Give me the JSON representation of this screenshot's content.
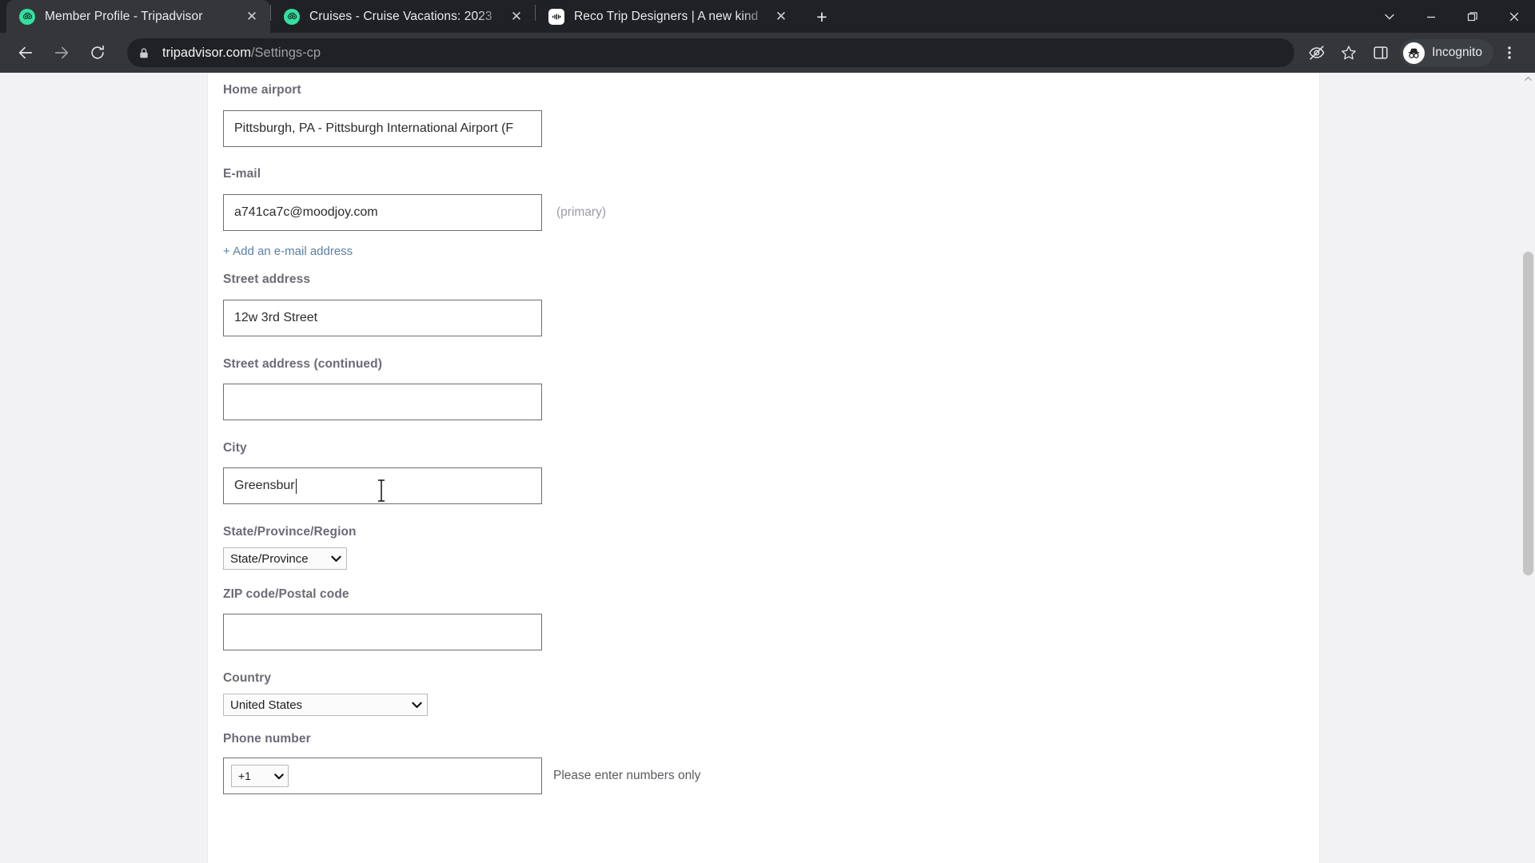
{
  "window": {
    "controls": {
      "tab_search": "tab-search-chevron",
      "minimize": "minimize",
      "maximize": "maximize",
      "close": "close"
    }
  },
  "tabstrip": {
    "new_tab_label": "+",
    "tabs": [
      {
        "title": "Member Profile - Tripadvisor",
        "favicon": "tripadvisor-owl-icon",
        "active": true,
        "close_label": "✕"
      },
      {
        "title": "Cruises - Cruise Vacations: 2023",
        "favicon": "tripadvisor-owl-icon",
        "active": false,
        "close_label": "✕"
      },
      {
        "title": "Reco Trip Designers | A new kind",
        "favicon": "reco-icon",
        "active": false,
        "close_label": "✕"
      }
    ]
  },
  "toolbar": {
    "back_label": "back-arrow",
    "forward_label": "forward-arrow",
    "reload_label": "reload",
    "security_icon": "lock-icon",
    "url_host": "tripadvisor.com",
    "url_path": "/Settings-cp",
    "url_full": "tripadvisor.com/Settings-cp",
    "icons": {
      "third_party_cookies": "eye-off-icon",
      "bookmark": "star-icon",
      "side_panel": "side-panel-icon",
      "menu": "three-dot-menu-icon"
    },
    "profile_label": "Incognito"
  },
  "page": {
    "fields": {
      "home_airport": {
        "label": "Home airport",
        "value": "Pittsburgh, PA - Pittsburgh International Airport (F"
      },
      "email": {
        "label": "E-mail",
        "value": "a741ca7c@moodjoy.com",
        "note": "(primary)",
        "add_link": "+ Add an e-mail address"
      },
      "street_address": {
        "label": "Street address",
        "value": "12w 3rd Street"
      },
      "street_address_continued": {
        "label": "Street address (continued)",
        "value": ""
      },
      "city": {
        "label": "City",
        "value": "Greensbur"
      },
      "state": {
        "label": "State/Province/Region",
        "value": "State/Province"
      },
      "zip": {
        "label": "ZIP code/Postal code",
        "value": ""
      },
      "country": {
        "label": "Country",
        "value": "United States"
      },
      "phone": {
        "label": "Phone number",
        "country_code": "+1",
        "value": "",
        "hint": "Please enter numbers only"
      }
    }
  },
  "colors": {
    "chrome_tabstrip": "#202124",
    "chrome_toolbar": "#35363a",
    "active_tab": "#35363a",
    "omnibox": "#202124",
    "tripadvisor_green": "#34e0a1",
    "link_blue": "#5b7fa6",
    "label_gray": "#6b6b76",
    "page_bg": "#f2f1f3"
  }
}
